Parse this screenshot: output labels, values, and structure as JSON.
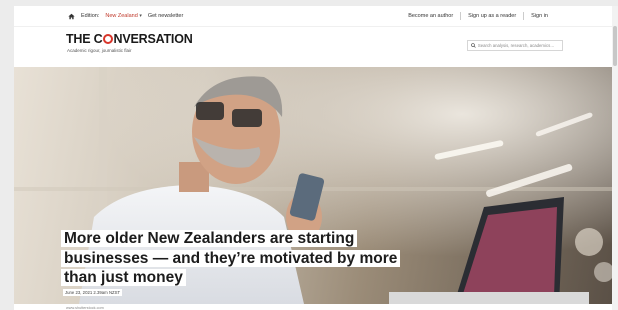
{
  "topbar": {
    "edition_label": "Edition:",
    "edition_value": "New Zealand",
    "newsletter": "Get newsletter",
    "become_author": "Become an author",
    "sign_up": "Sign up as a reader",
    "sign_in": "Sign in"
  },
  "masthead": {
    "logo_part1": "THE C",
    "logo_part2": "NVERSATION",
    "tagline": "Academic rigour, journalistic flair"
  },
  "search": {
    "placeholder": "Search analysis, research, academics…"
  },
  "article": {
    "headline": "More older New Zealanders are starting businesses — and they’re motivated by more than just money",
    "date": "June 23, 2021 2.39am NZST",
    "image_credit": "www.shutterstock.com"
  },
  "colors": {
    "brand_red": "#d8352a",
    "edition_red": "#c0392b"
  },
  "icons": {
    "home": "home-icon",
    "search": "search-icon",
    "dropdown": "chevron-down-icon"
  }
}
